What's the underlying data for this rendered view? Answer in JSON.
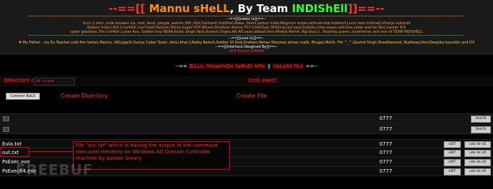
{
  "banner": {
    "title_dashes_left": "--==[[",
    "title_name": "Mannu sHeLL",
    "title_by": ", By Team",
    "title_team": "INDIShEll",
    "title_dashes_right": "]]==--",
    "greetz_label": "--==[[Greetz to]]==--",
    "greetz_line1": "Guru ji zero ,code breaker ica, root_devil, google_warrior,INX_r0ot,Darkwolf indiShell,Baba ,Silent poison India,Magnum sniper,ethicalnoob Indishell,Local root indishell,Irfninja indishell",
    "greetz_line2": "Reborn India,L0rd Crus4d3r,cool toad,Hackuin,Alicks,Gujjar PCP,Bikash,Dinelson Amine,Th3 D3str0yer,SKSking,rad paul,Godzila,mike waals,ne0-2oo,cyber warrior,Neo hacker ICA",
    "greetz_line3": "cyber gladiator,7he Cre4t0r,Cyber Ace, Golden boy INDIA,Ketan Singh,Yash,Aneesh Dogra,AR AR,saad abbasi,hero,Minhal Mehdi ,Raj bhai ji , Hacking queen ,lovetherisk and rest of TEAM INDISHELL",
    "love_label": "--==[[Love to]]==--",
    "love_line": "# My Father , my Ex Teacher,cold fire hacker,Mannu, ViKi,Jagriti,Suriya Cyber Tyson ,Ashu bhai ji,Rafay Baloch,Soldier Of God,Shafoon,Rehan Manzoor,almas malik, Bhuppi,Mohit, Ffe ^_^,Govind Singh,Shardhanand ,Budhaoo,Don(Deepika kaushik) and D3",
    "interface_label": "--==[[Interface Desgined By]]==--",
    "interface_by": "GCE Kumar GINNAS"
  },
  "nav": {
    "sep_left": "--==",
    "server_info": "BiLLu, Show/HiDe SeRvEr InFo",
    "divider": "||",
    "upload": "UpLoAd FiLe",
    "sep_right": "==--"
  },
  "controls": {
    "change_dir_label": "DiReCtOrY cH",
    "cmd_input_value": "cd ~c-one",
    "cmd_exec_label": "CmD eXeCt",
    "connect_back": "Connect BaCk",
    "create_dir": "Create Directory",
    "create_file": "Create File"
  },
  "files": {
    "rows": [
      {
        "name": ".",
        "perm": "0777",
        "is_dir": true
      },
      {
        "name": "..",
        "perm": "0777",
        "is_dir": true
      },
      {
        "name": "Eula.txt",
        "perm": "0777",
        "is_dir": false
      },
      {
        "name": "out.txt",
        "perm": "0777",
        "is_dir": false
      },
      {
        "name": "PsExec.exe",
        "perm": "0777",
        "is_dir": false
      },
      {
        "name": "PsExec64.exe",
        "perm": "0777",
        "is_dir": false
      }
    ],
    "edit_label": "eDiT",
    "delete_label": "DeleTe",
    "download_label": "uda de xD"
  },
  "annotation": {
    "callout_text": "File \"out.txt\" which is having the output of the command executed remotely on Windows AD Domain Controller machine by psexec binary."
  },
  "watermark": "FREEBUF"
}
